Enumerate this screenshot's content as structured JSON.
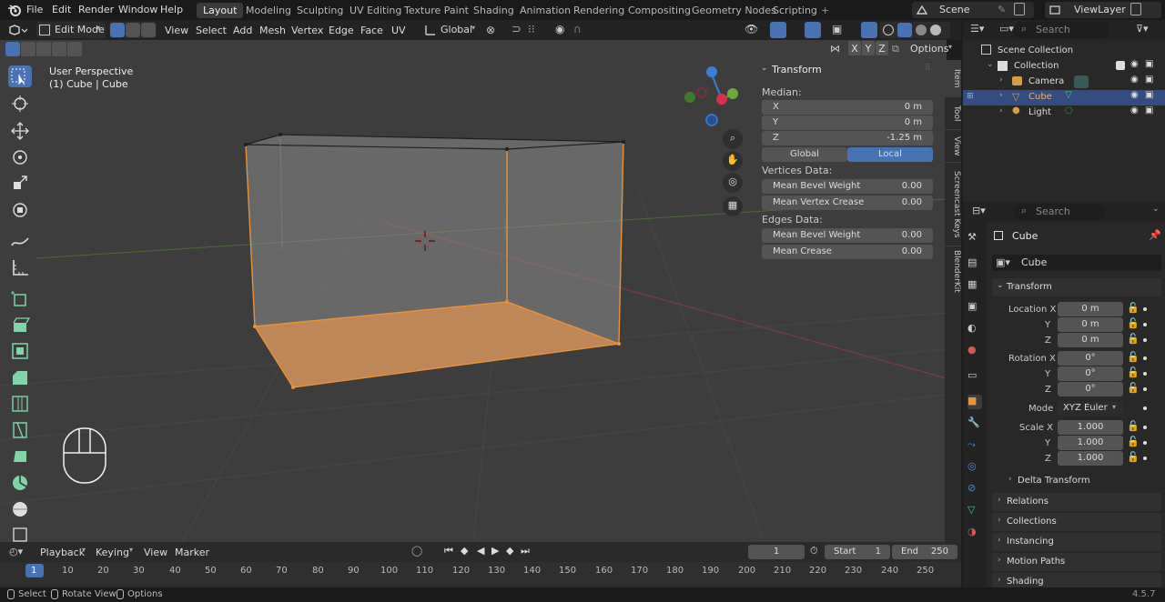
{
  "topbar": {
    "menus": [
      "File",
      "Edit",
      "Render",
      "Window",
      "Help"
    ],
    "workspaces": [
      "Layout",
      "Modeling",
      "Sculpting",
      "UV Editing",
      "Texture Paint",
      "Shading",
      "Animation",
      "Rendering",
      "Compositing",
      "Geometry Nodes",
      "Scripting"
    ],
    "active_workspace": "Layout",
    "add_tab": "+",
    "scene": "Scene",
    "view_layer": "ViewLayer"
  },
  "viewport_header": {
    "mode": "Edit Mode",
    "menus": [
      "View",
      "Select",
      "Add",
      "Mesh",
      "Vertex",
      "Edge",
      "Face",
      "UV"
    ],
    "orientation": "Global",
    "options_label": "Options",
    "axis_x": "X",
    "axis_y": "Y",
    "axis_z": "Z"
  },
  "viewport": {
    "perspective": "User Perspective",
    "object_info": "(1) Cube | Cube"
  },
  "n_panel": {
    "title": "Transform",
    "median_label": "Median:",
    "median": [
      {
        "label": "X",
        "value": "0 m"
      },
      {
        "label": "Y",
        "value": "0 m"
      },
      {
        "label": "Z",
        "value": "-1.25 m"
      }
    ],
    "space_global": "Global",
    "space_local": "Local",
    "vertices_label": "Vertices Data:",
    "vertices": [
      {
        "label": "Mean Bevel Weight",
        "value": "0.00"
      },
      {
        "label": "Mean Vertex Crease",
        "value": "0.00"
      }
    ],
    "edges_label": "Edges Data:",
    "edges": [
      {
        "label": "Mean Bevel Weight",
        "value": "0.00"
      },
      {
        "label": "Mean Crease",
        "value": "0.00"
      }
    ],
    "side_tabs": [
      "Item",
      "Tool",
      "View",
      "Screencast Keys",
      "BlenderKit"
    ]
  },
  "outliner": {
    "search_placeholder": "Search",
    "scene_collection": "Scene Collection",
    "collection": "Collection",
    "items": [
      {
        "label": "Camera"
      },
      {
        "label": "Cube"
      },
      {
        "label": "Light"
      }
    ]
  },
  "properties": {
    "search_placeholder": "Search",
    "object_name": "Cube",
    "object_field": "Cube",
    "transform_title": "Transform",
    "location_label": "Location X",
    "location": [
      "0 m",
      "0 m",
      "0 m"
    ],
    "rotation_label": "Rotation X",
    "rotation": [
      "0°",
      "0°",
      "0°"
    ],
    "mode_label": "Mode",
    "mode_value": "XYZ Euler",
    "scale_label": "Scale X",
    "scale": [
      "1.000",
      "1.000",
      "1.000"
    ],
    "axis_y": "Y",
    "axis_z": "Z",
    "sections": [
      "Delta Transform",
      "Relations",
      "Collections",
      "Instancing",
      "Motion Paths",
      "Shading"
    ]
  },
  "timeline": {
    "menus": [
      "Playback",
      "Keying",
      "View",
      "Marker"
    ],
    "current_frame": "1",
    "start_label": "Start",
    "start_value": "1",
    "end_label": "End",
    "end_value": "250",
    "ticks": [
      "1",
      "10",
      "20",
      "30",
      "40",
      "50",
      "60",
      "70",
      "80",
      "90",
      "100",
      "110",
      "120",
      "130",
      "140",
      "150",
      "160",
      "170",
      "180",
      "190",
      "200",
      "210",
      "220",
      "230",
      "240",
      "250"
    ]
  },
  "statusbar": {
    "select": "Select",
    "rotate": "Rotate View",
    "options": "Options",
    "version": "4.5.7"
  },
  "colors": {
    "accent": "#4772b3",
    "selection": "#e8923a",
    "face_fill": "#c98a55"
  }
}
